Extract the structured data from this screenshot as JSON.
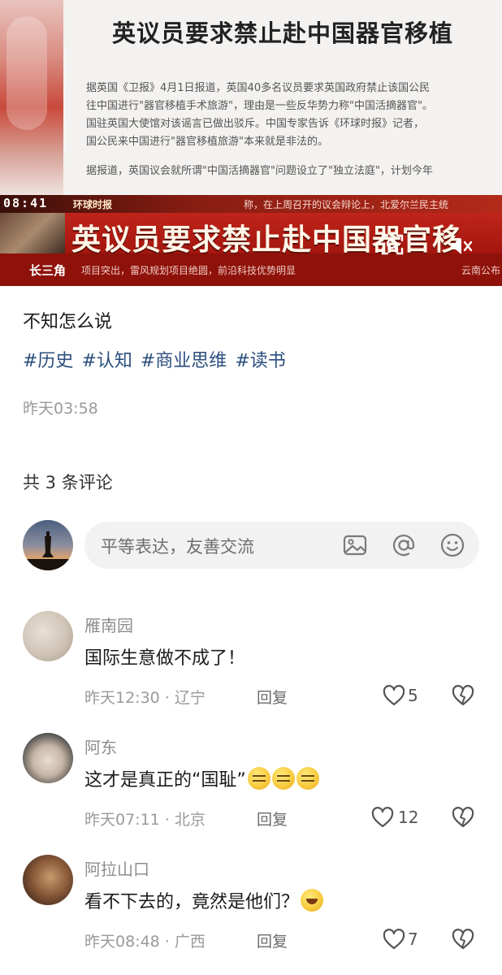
{
  "hero": {
    "headline": "英议员要求禁止赴中国器官移植",
    "article_lines": [
      "据英国《卫报》4月1日报道，英国40多名议员要求英国政府禁止该国公民",
      "往中国进行\"器官移植手术旅游\"，理由是一些反华势力称\"中国活摘器官\"。",
      "国驻英国大使馆对该谣言已做出驳斥。中国专家告诉《环球时报》记者，",
      "国公民来中国进行\"器官移植旅游\"本来就是非法的。",
      "据报道，英国议会就所谓\"中国活摘器官\"问题设立了\"独立法庭\"，计划今年"
    ],
    "time": "08:41",
    "channel": "环球时报",
    "ticker_extra": "称，在上周召开的议会辩论上，北爱尔兰民主统",
    "banner_title": "英议员要求禁止赴中国器官移",
    "region": "长三角",
    "bottom_ticker": "项目突出，雷风规划项目绝圆，前沿科技优势明显",
    "bottom_right": "云南公布"
  },
  "post": {
    "text": "不知怎么说",
    "tags": [
      "#历史",
      "#认知",
      "#商业思维",
      "#读书"
    ],
    "time": "昨天03:58"
  },
  "comments_header": "共 3 条评论",
  "input": {
    "placeholder": "平等表达，友善交流",
    "icons": [
      "image-icon",
      "at-icon",
      "emoji-icon"
    ]
  },
  "comments": [
    {
      "name": "雁南园",
      "text": "国际生意做不成了！",
      "emojis": [],
      "meta": "昨天12:30 · 辽宁",
      "reply": "回复",
      "likes": "5"
    },
    {
      "name": "阿东",
      "text": "这才是真正的“国耻”",
      "emojis": [
        "sigh",
        "sigh",
        "sigh"
      ],
      "meta": "昨天07:11 · 北京",
      "reply": "回复",
      "likes": "12"
    },
    {
      "name": "阿拉山口",
      "text": "看不下去的，竟然是他们？",
      "emojis": [
        "laugh-cry"
      ],
      "meta": "昨天08:48 · 广西",
      "reply": "回复",
      "likes": "7"
    }
  ],
  "colors": {
    "tag": "#2b4e7e",
    "banner_red": "#c0241a",
    "muted_text": "#9a9a9a"
  }
}
